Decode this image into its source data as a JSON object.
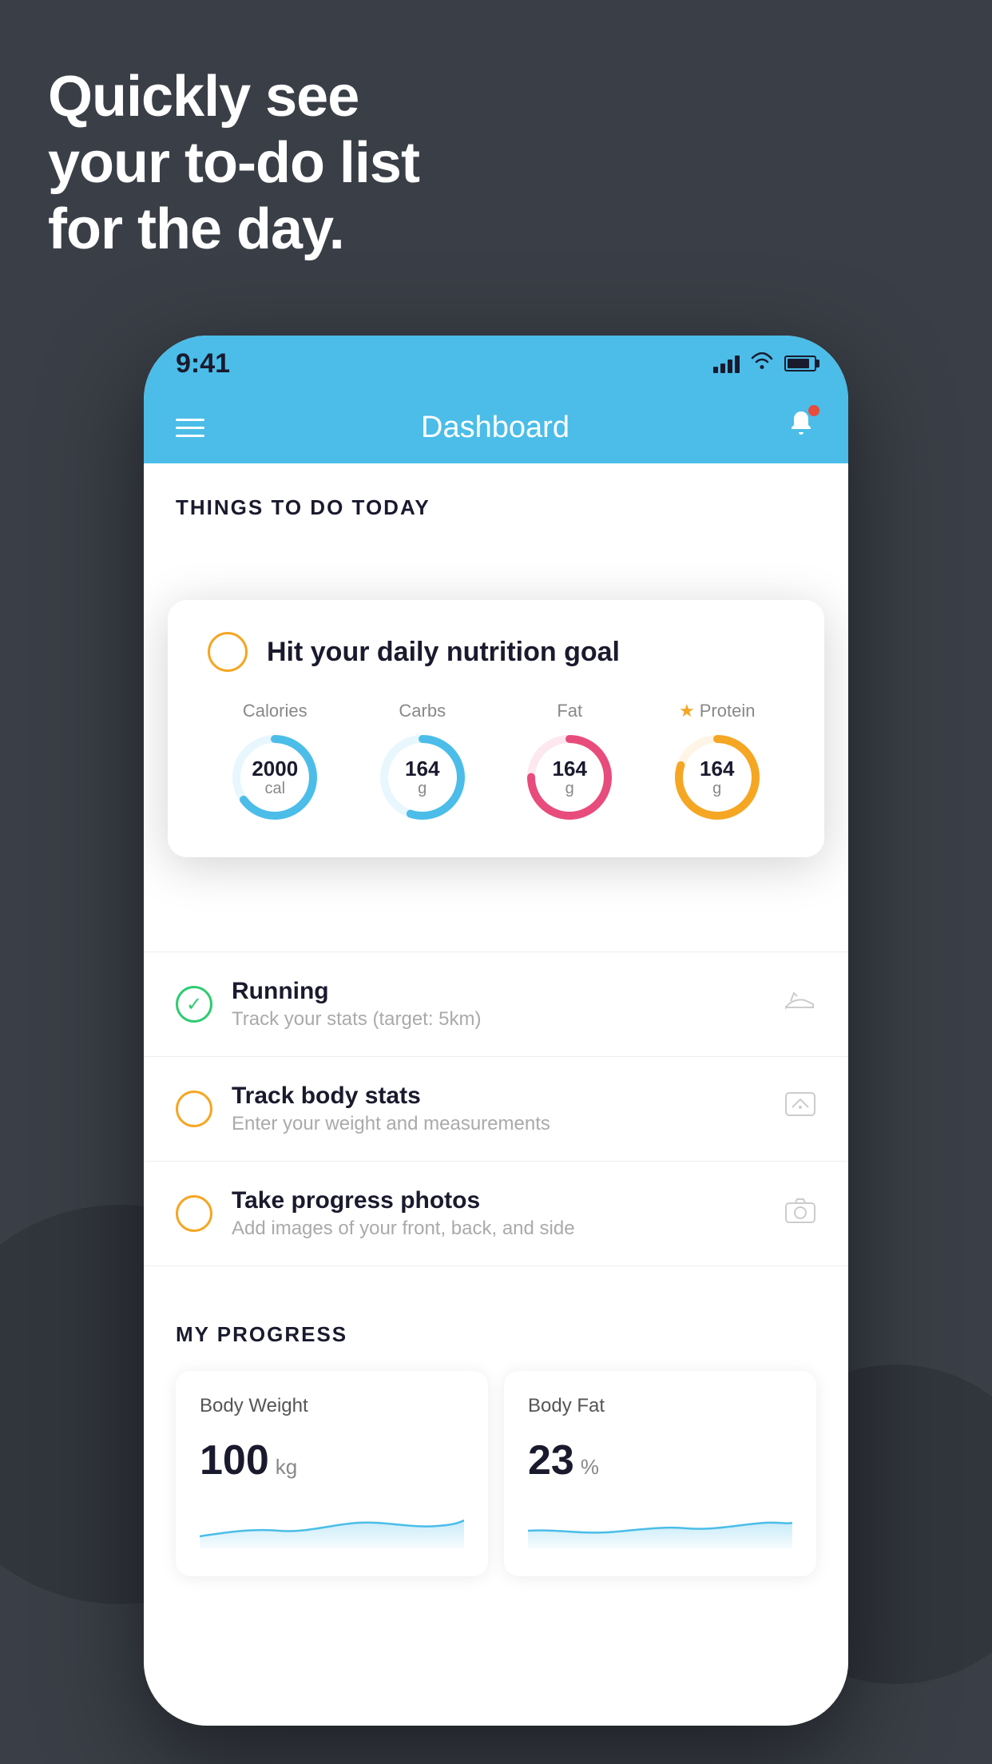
{
  "hero": {
    "line1": "Quickly see",
    "line2": "your to-do list",
    "line3": "for the day."
  },
  "status_bar": {
    "time": "9:41"
  },
  "nav": {
    "title": "Dashboard"
  },
  "things_header": "THINGS TO DO TODAY",
  "nutrition_card": {
    "title": "Hit your daily nutrition goal",
    "macros": [
      {
        "label": "Calories",
        "value": "2000",
        "unit": "cal",
        "color": "#4bbde8",
        "track_color": "#e8f7fd",
        "percent": 65
      },
      {
        "label": "Carbs",
        "value": "164",
        "unit": "g",
        "color": "#4bbde8",
        "track_color": "#e8f7fd",
        "percent": 55
      },
      {
        "label": "Fat",
        "value": "164",
        "unit": "g",
        "color": "#e74c7c",
        "track_color": "#fde8ef",
        "percent": 75
      },
      {
        "label": "Protein",
        "value": "164",
        "unit": "g",
        "color": "#f5a623",
        "track_color": "#fef5e7",
        "percent": 80,
        "starred": true
      }
    ]
  },
  "todo_items": [
    {
      "title": "Running",
      "subtitle": "Track your stats (target: 5km)",
      "status": "done",
      "icon": "shoe"
    },
    {
      "title": "Track body stats",
      "subtitle": "Enter your weight and measurements",
      "status": "pending",
      "icon": "scale"
    },
    {
      "title": "Take progress photos",
      "subtitle": "Add images of your front, back, and side",
      "status": "pending",
      "icon": "camera"
    }
  ],
  "progress": {
    "header": "MY PROGRESS",
    "cards": [
      {
        "title": "Body Weight",
        "value": "100",
        "unit": "kg"
      },
      {
        "title": "Body Fat",
        "value": "23",
        "unit": "%"
      }
    ]
  }
}
